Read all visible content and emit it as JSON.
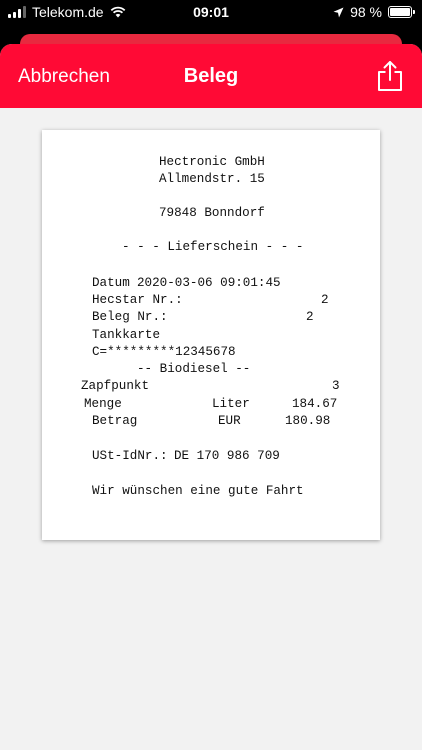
{
  "status_bar": {
    "carrier": "Telekom.de",
    "time": "09:01",
    "battery": "98 %"
  },
  "nav": {
    "cancel_label": "Abbrechen",
    "title": "Beleg"
  },
  "receipt": {
    "company": "Hectronic GmbH",
    "street": "Allmendstr. 15",
    "city": "79848 Bonndorf",
    "doc_type": "- - - Lieferschein - - -",
    "datum_label": "Datum",
    "datum_value": "2020-03-06 09:01:45",
    "hecstar_label": "Hecstar Nr.:",
    "hecstar_value": "2",
    "beleg_label": "Beleg Nr.:",
    "beleg_value": "2",
    "tankkarte_label": "Tankkarte",
    "card_number": "C=*********12345678",
    "product": "-- Biodiesel --",
    "zapfpunkt_label": "Zapfpunkt",
    "zapfpunkt_value": "3",
    "menge_label": "Menge",
    "menge_unit": "Liter",
    "menge_value": "184.67",
    "betrag_label": "Betrag",
    "betrag_unit": "EUR",
    "betrag_value": "180.98",
    "ust_label": "USt-IdNr.:",
    "ust_value": "DE 170 986 709",
    "greeting": "Wir wünschen eine gute Fahrt"
  }
}
